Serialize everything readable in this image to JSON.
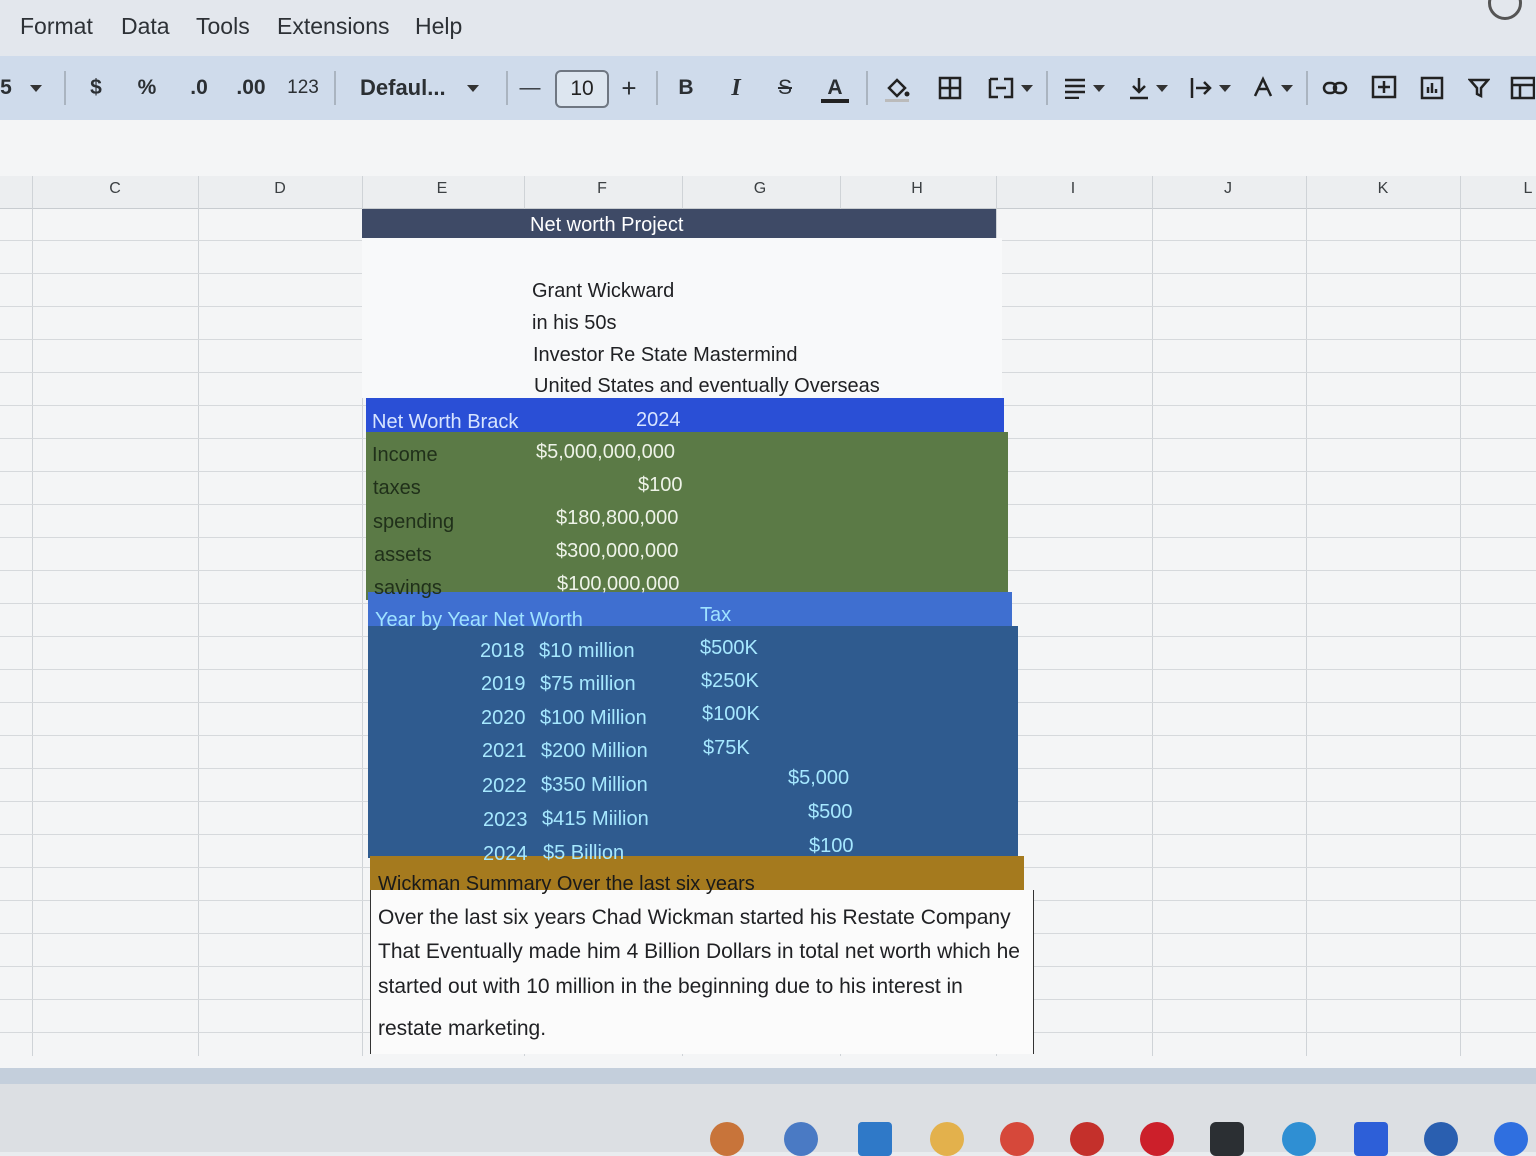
{
  "menu": [
    "Format",
    "Data",
    "Tools",
    "Extensions",
    "Help"
  ],
  "toolbar": {
    "zoom_partial": "5",
    "currency": "$",
    "percent": "%",
    "decrease_decimal": ".0",
    "increase_decimal": ".00",
    "number_format": "123",
    "font_name": "Defaul...",
    "minus": "—",
    "font_size": "10",
    "plus": "+",
    "bold": "B",
    "italic": "I",
    "strike": "S",
    "text_color": "A",
    "icons": [
      "fill-color-icon",
      "borders-icon",
      "merge-cells-icon",
      "align-icon",
      "valign-icon",
      "wrap-icon",
      "rotate-icon",
      "link-icon",
      "comment-icon",
      "chart-icon",
      "filter-icon",
      "filter-views-icon"
    ]
  },
  "columns": [
    "C",
    "D",
    "E",
    "F",
    "G",
    "H",
    "I",
    "J",
    "K",
    "L"
  ],
  "sheet": {
    "title": "Net worth Project",
    "name": "Grant Wickward",
    "age": "in his 50s",
    "role": "Investor Re State Mastermind",
    "location": "United States and eventually Overseas",
    "bracket_label": "Net Worth Brack",
    "bracket_year": "2024",
    "finances": [
      {
        "label": "Income",
        "value": "$5,000,000,000"
      },
      {
        "label": "taxes",
        "value": "$100"
      },
      {
        "label": "spending",
        "value": "$180,800,000"
      },
      {
        "label": "assets",
        "value": "$300,000,000"
      },
      {
        "label": "savings",
        "value": "$100,000,000"
      }
    ],
    "yearly_header": "Year by Year Net Worth",
    "tax_header": "Tax",
    "yearly": [
      {
        "year": "2018",
        "worth": "$10 million",
        "tax": "$500K",
        "extra": ""
      },
      {
        "year": "2019",
        "worth": "$75 million",
        "tax": "$250K",
        "extra": ""
      },
      {
        "year": "2020",
        "worth": "$100 Million",
        "tax": "$100K",
        "extra": ""
      },
      {
        "year": "2021",
        "worth": "$200 Million",
        "tax": "$75K",
        "extra": ""
      },
      {
        "year": "2022",
        "worth": "$350 Million",
        "tax": "",
        "extra": "$5,000"
      },
      {
        "year": "2023",
        "worth": "$415 Miilion",
        "tax": "",
        "extra": "$500"
      },
      {
        "year": "2024",
        "worth": "$5 Billion",
        "tax": "",
        "extra": "$100"
      }
    ],
    "summary_header": "Wickman Summary Over the last six years",
    "summary_lines": [
      "Over the last six years Chad Wickman started his Restate Company",
      "That Eventually made him 4 Billion Dollars in total net worth which he",
      "started out with 10 million in the beginning due to his interest in",
      "restate marketing."
    ]
  },
  "colors": {
    "dark_header": "#3e4a66",
    "bright_blue": "#2a4fd6",
    "green": "#5b7a46",
    "mid_blue": "#3f6fd0",
    "steel_blue": "#2f5b8f",
    "mustard": "#a57a1e"
  }
}
